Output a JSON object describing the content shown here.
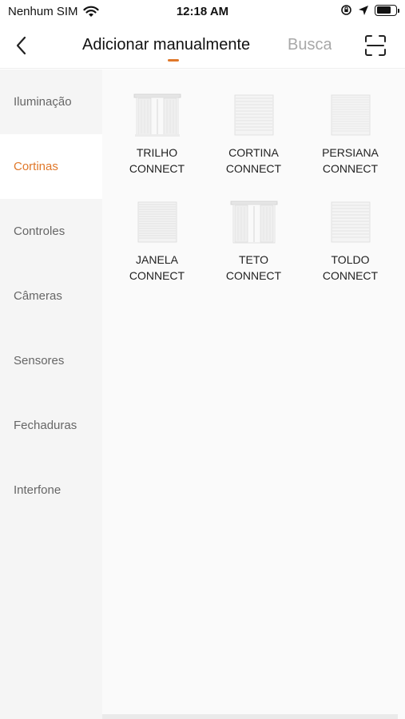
{
  "status_bar": {
    "carrier": "Nenhum SIM",
    "time": "12:18 AM",
    "battery_level": 0.75
  },
  "header": {
    "tab_active": "Adicionar manualmente",
    "tab_inactive": "Buscar",
    "back_icon": "chevron-left-icon",
    "scan_icon": "scan-icon"
  },
  "colors": {
    "accent": "#e0782a",
    "sidebar_bg": "#f5f5f5",
    "content_bg": "#fafafa"
  },
  "sidebar": {
    "items": [
      {
        "label": "Iluminação",
        "active": false
      },
      {
        "label": "Cortinas",
        "active": true
      },
      {
        "label": "Controles",
        "active": false
      },
      {
        "label": "Câmeras",
        "active": false
      },
      {
        "label": "Sensores",
        "active": false
      },
      {
        "label": "Fechaduras",
        "active": false
      },
      {
        "label": "Interfone",
        "active": false
      }
    ]
  },
  "devices": [
    {
      "line1": "TRILHO",
      "line2": "CONNECT",
      "icon": "curtain-rail-icon"
    },
    {
      "line1": "CORTINA",
      "line2": "CONNECT",
      "icon": "roller-blind-icon"
    },
    {
      "line1": "PERSIANA",
      "line2": "CONNECT",
      "icon": "venetian-blind-icon"
    },
    {
      "line1": "JANELA",
      "line2": "CONNECT",
      "icon": "window-blind-icon"
    },
    {
      "line1": "TETO",
      "line2": "CONNECT",
      "icon": "ceiling-curtain-icon"
    },
    {
      "line1": "TOLDO",
      "line2": "CONNECT",
      "icon": "awning-icon"
    }
  ]
}
